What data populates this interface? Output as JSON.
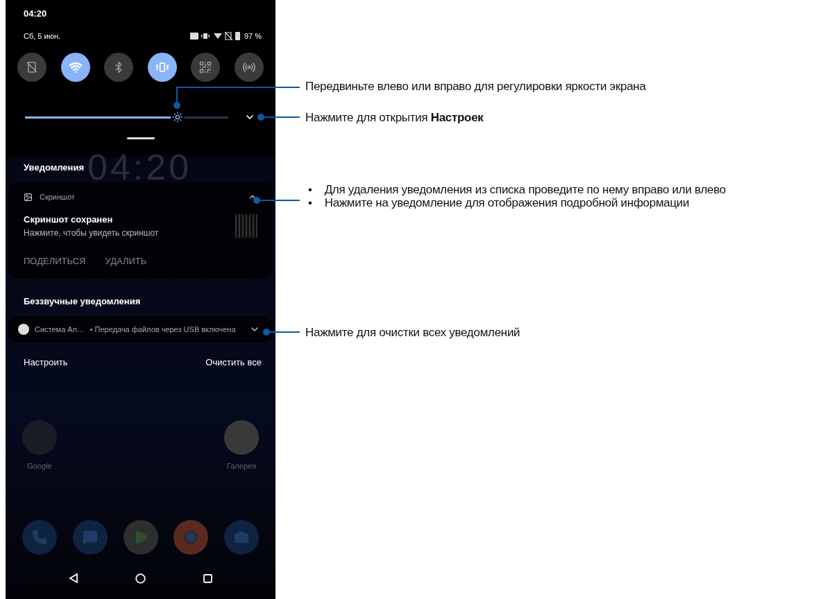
{
  "status_bar": {
    "time": "04:20"
  },
  "header": {
    "date": "Сб, 5 июн.",
    "battery": "97 %"
  },
  "quick_tiles": [
    {
      "kind": "sim",
      "on": false
    },
    {
      "kind": "wifi",
      "on": true
    },
    {
      "kind": "bluetooth",
      "on": false
    },
    {
      "kind": "vibrate",
      "on": true
    },
    {
      "kind": "qr",
      "on": false
    },
    {
      "kind": "hotspot",
      "on": false
    }
  ],
  "brightness": {
    "level": 0.75
  },
  "clock_large": "04:20",
  "notifications_title": "Уведомления",
  "notification": {
    "app": "Скриншот",
    "title": "Скриншот сохранен",
    "text": "Нажмите, чтобы увидеть скриншот",
    "expanded": true,
    "actions": [
      "ПОДЕЛИТЬСЯ",
      "УДАЛИТЬ"
    ]
  },
  "silent_title": "Беззвучные уведомления",
  "silent_notification": {
    "app": "Система Ап…",
    "text": "• Передача файлов через USB включена",
    "expanded": false
  },
  "footer_buttons": [
    "Настроить",
    "Очистить все"
  ],
  "home_apps": [
    "Google",
    "Галерея"
  ],
  "callouts": [
    {
      "kind": "text",
      "text": "Передвиньте влево или вправо для регулировки яркости экрана"
    },
    {
      "kind": "text",
      "text": "Нажмите для открытия **Настроек**"
    },
    {
      "kind": "bullets",
      "items": [
        {
          "bullet": "•",
          "text": "Для удаления уведомления из списка проведите по нему вправо или влево"
        },
        {
          "bullet": "•",
          "text": "Нажмите на уведомление для отображения подробной информации"
        }
      ]
    },
    {
      "kind": "text",
      "text": "Нажмите для очистки всех уведомлений"
    }
  ]
}
